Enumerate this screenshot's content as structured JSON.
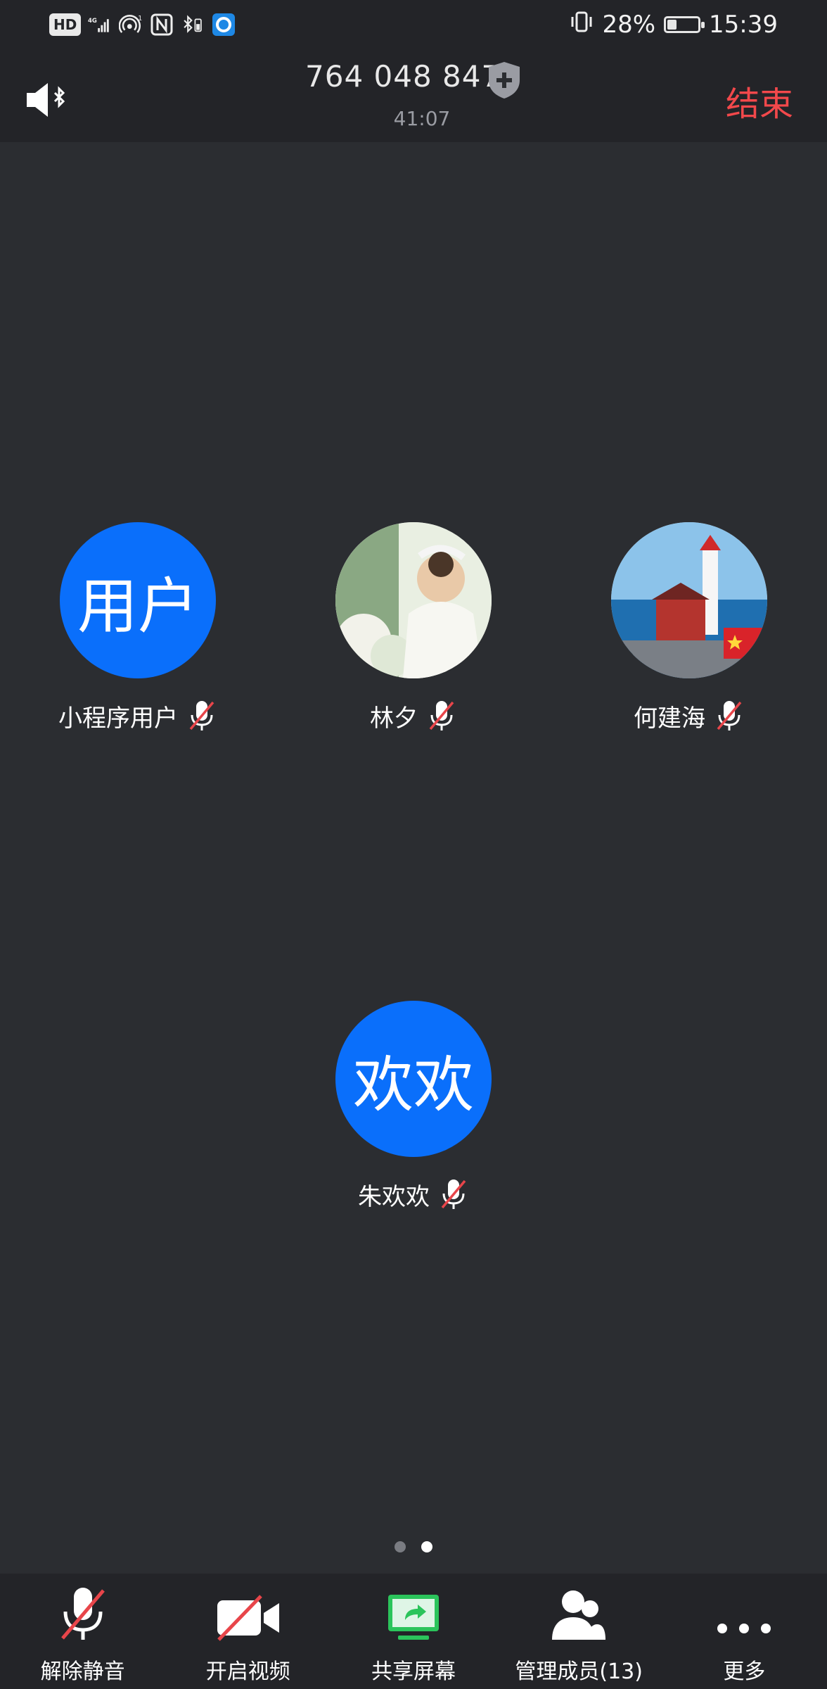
{
  "status_bar": {
    "hd_badge": "HD",
    "network": "4G",
    "hotspot_count": "1",
    "battery_percent_text": "28%",
    "battery_level": 0.28,
    "time": "15:39"
  },
  "header": {
    "meeting_id": "764 048 847",
    "duration": "41:07",
    "end_label": "结束"
  },
  "participants": [
    {
      "name": "小程序用户",
      "avatar_text": "用户",
      "avatar_type": "text",
      "muted": true
    },
    {
      "name": "林夕",
      "avatar_text": "",
      "avatar_type": "photo-child",
      "muted": true
    },
    {
      "name": "何建海",
      "avatar_text": "",
      "avatar_type": "photo-lighthouse",
      "muted": true
    },
    {
      "name": "朱欢欢",
      "avatar_text": "欢欢",
      "avatar_type": "text",
      "muted": true
    }
  ],
  "pagination": {
    "pages": 2,
    "current": 2
  },
  "toolbar": {
    "unmute_label": "解除静音",
    "video_label": "开启视频",
    "share_label": "共享屏幕",
    "members_label": "管理成员(13)",
    "more_label": "更多"
  },
  "colors": {
    "accent_blue": "#0a6ffb",
    "end_red": "#f2484b",
    "mute_red": "#e8454a",
    "share_green": "#2bc45b",
    "background": "#2b2d31",
    "bar": "#232428"
  }
}
